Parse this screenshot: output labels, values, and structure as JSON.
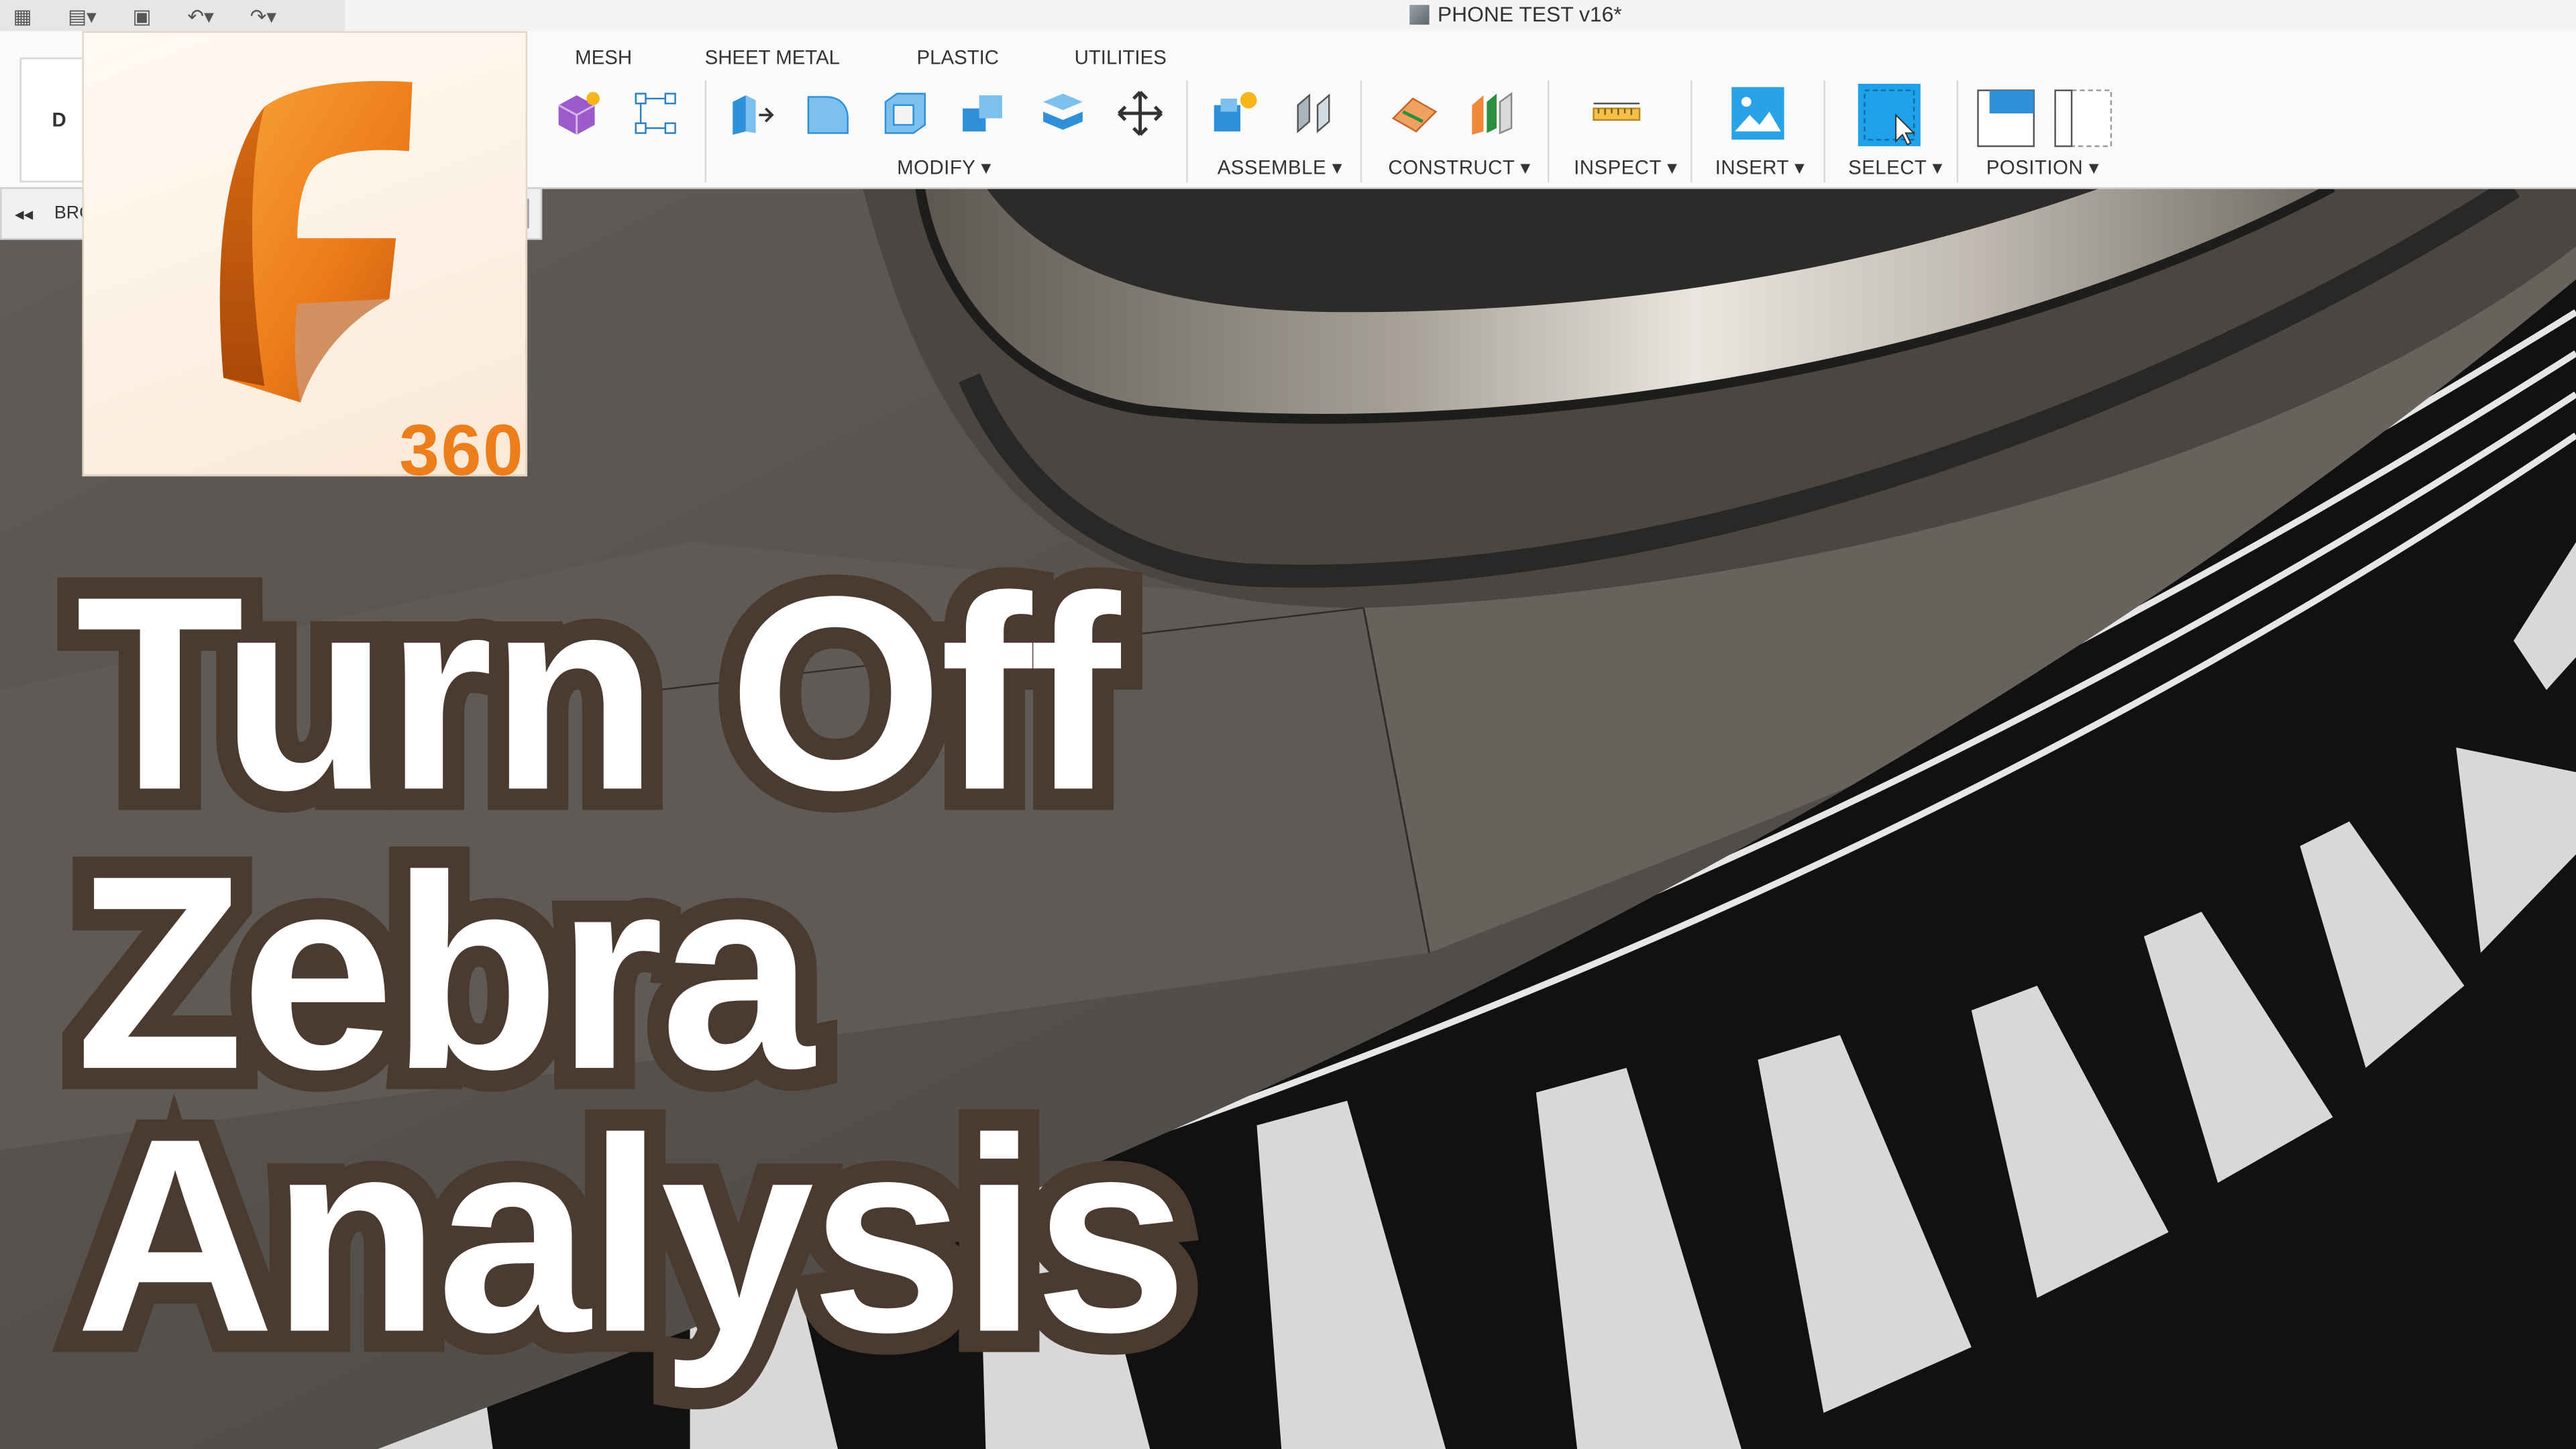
{
  "window": {
    "title": "PHONE TEST v16*"
  },
  "ribbon": {
    "tabs": [
      "MESH",
      "SHEET METAL",
      "PLASTIC",
      "UTILITIES"
    ],
    "workspace_button": "D",
    "groups": [
      "MODIFY",
      "ASSEMBLE",
      "CONSTRUCT",
      "INSPECT",
      "INSERT",
      "SELECT",
      "POSITION"
    ]
  },
  "browser": {
    "label": "BRO"
  },
  "logo": {
    "badge": "360",
    "letter": "F"
  },
  "headline": {
    "line1": "Turn Off",
    "line2": "Zebra",
    "line3": "Analysis"
  },
  "colors": {
    "accent_orange": "#ee7d1b",
    "select_blue": "#1ea1e8",
    "headline_outline": "#4b3a30"
  }
}
